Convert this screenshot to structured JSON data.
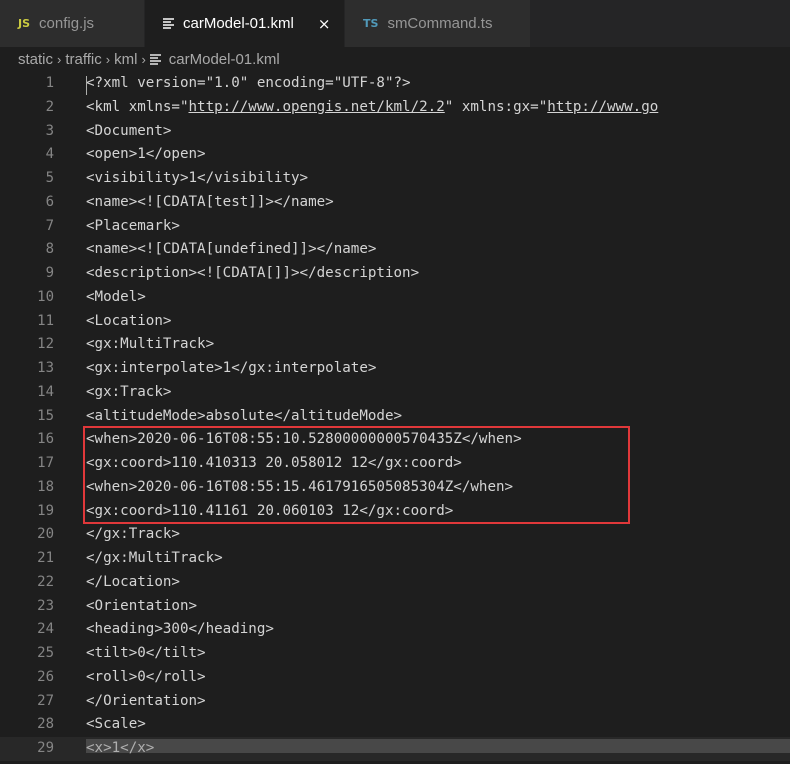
{
  "tabs": [
    {
      "badge": "JS",
      "label": "config.js",
      "active": false
    },
    {
      "label": "carModel-01.kml",
      "active": true,
      "close": "×"
    },
    {
      "badge": "TS",
      "label": "smCommand.ts",
      "active": false
    }
  ],
  "breadcrumb": [
    "static",
    "traffic",
    "kml",
    "carModel-01.kml"
  ],
  "breadcrumb_separator": "›",
  "editor": {
    "lines": [
      {
        "n": "1",
        "t": "<?xml version=\"1.0\" encoding=\"UTF-8\"?>"
      },
      {
        "n": "2",
        "t": "<kml xmlns=\"http://www.opengis.net/kml/2.2\" xmlns:gx=\"http://www.go",
        "links": [
          "http://www.opengis.net/kml/2.2",
          "http://www.go"
        ]
      },
      {
        "n": "3",
        "t": "<Document>"
      },
      {
        "n": "4",
        "t": "<open>1</open>"
      },
      {
        "n": "5",
        "t": "<visibility>1</visibility>"
      },
      {
        "n": "6",
        "t": "<name><![CDATA[test]]></name>"
      },
      {
        "n": "7",
        "t": "<Placemark>"
      },
      {
        "n": "8",
        "t": "<name><![CDATA[undefined]]></name>"
      },
      {
        "n": "9",
        "t": "<description><![CDATA[]]></description>"
      },
      {
        "n": "10",
        "t": "<Model>"
      },
      {
        "n": "11",
        "t": "<Location>"
      },
      {
        "n": "12",
        "t": "<gx:MultiTrack>"
      },
      {
        "n": "13",
        "t": "<gx:interpolate>1</gx:interpolate>"
      },
      {
        "n": "14",
        "t": "<gx:Track>"
      },
      {
        "n": "15",
        "t": "<altitudeMode>absolute</altitudeMode>"
      },
      {
        "n": "16",
        "t": "<when>2020-06-16T08:55:10.52800000000570435Z</when>"
      },
      {
        "n": "17",
        "t": "<gx:coord>110.410313 20.058012 12</gx:coord>"
      },
      {
        "n": "18",
        "t": "<when>2020-06-16T08:55:15.4617916505085304Z</when>"
      },
      {
        "n": "19",
        "t": "<gx:coord>110.41161 20.060103 12</gx:coord>"
      },
      {
        "n": "20",
        "t": "</gx:Track>"
      },
      {
        "n": "21",
        "t": "</gx:MultiTrack>"
      },
      {
        "n": "22",
        "t": "</Location>"
      },
      {
        "n": "23",
        "t": "<Orientation>"
      },
      {
        "n": "24",
        "t": "<heading>300</heading>"
      },
      {
        "n": "25",
        "t": "<tilt>0</tilt>"
      },
      {
        "n": "26",
        "t": "<roll>0</roll>"
      },
      {
        "n": "27",
        "t": "</Orientation>"
      },
      {
        "n": "28",
        "t": "<Scale>"
      },
      {
        "n": "29",
        "t": "<x>1</x>",
        "current": true
      }
    ],
    "highlighted_lines": [
      "16",
      "17",
      "18",
      "19"
    ],
    "colors": {
      "background": "#1e1e1e",
      "text": "#d4d4d4",
      "line_number": "#858585",
      "highlight_border": "#e0383a",
      "js_badge": "#cbcb41",
      "ts_badge": "#519aba"
    }
  }
}
